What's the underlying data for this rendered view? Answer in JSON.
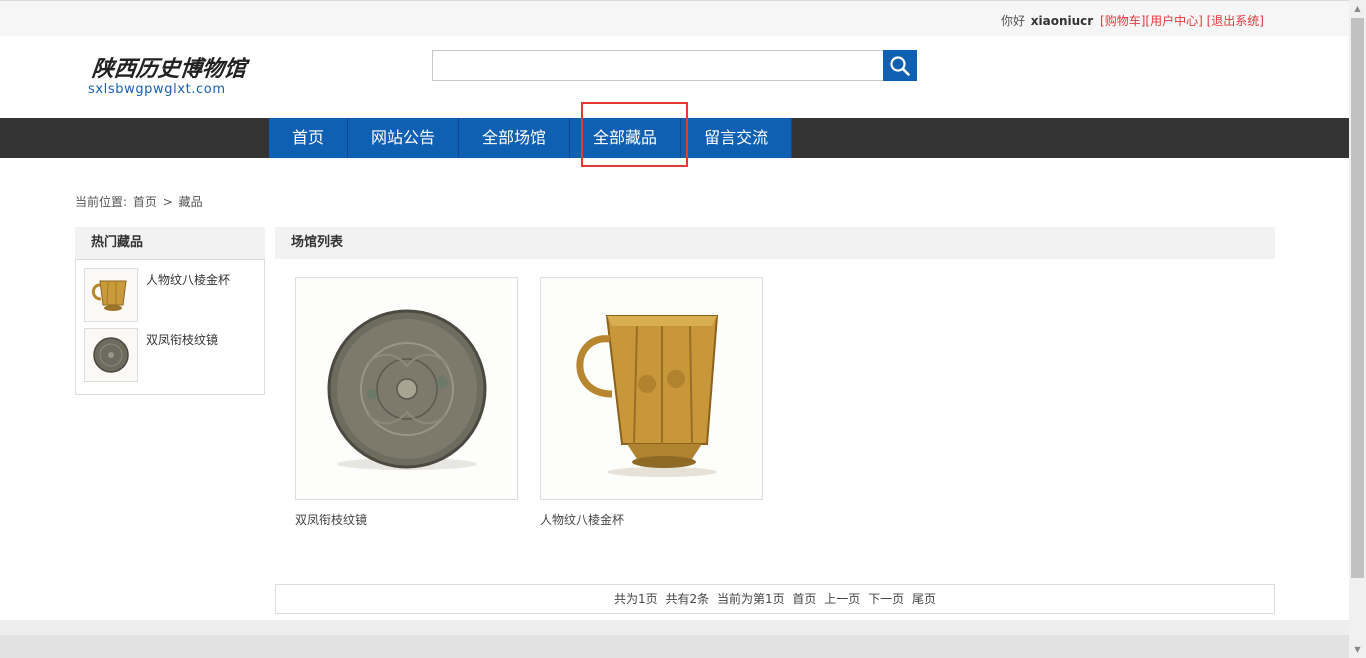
{
  "topbar": {
    "greeting": "你好",
    "username": "xiaoniucr",
    "links": [
      "[购物车]",
      "[用户中心]",
      "[退出系统]"
    ]
  },
  "header": {
    "logo_title": "陕西历史博物馆",
    "logo_sub": "sxlsbwgpwglxt.com",
    "search": {
      "value": "",
      "placeholder": ""
    }
  },
  "nav": {
    "items": [
      "首页",
      "网站公告",
      "全部场馆",
      "全部藏品",
      "留言交流"
    ],
    "highlighted": "全部藏品"
  },
  "breadcrumb": {
    "prefix": "当前位置:",
    "home": "首页",
    "sep": ">",
    "current": "藏品"
  },
  "sidebar": {
    "title": "热门藏品",
    "items": [
      {
        "label": "人物纹八棱金杯",
        "icon": "gold-cup-icon"
      },
      {
        "label": "双凤衔枝纹镜",
        "icon": "bronze-mirror-icon"
      }
    ]
  },
  "main": {
    "title": "场馆列表",
    "cards": [
      {
        "label": "双凤衔枝纹镜",
        "icon": "bronze-mirror-image"
      },
      {
        "label": "人物纹八棱金杯",
        "icon": "gold-cup-image"
      }
    ]
  },
  "pager": {
    "total_pages": "共为1页",
    "total_items": "共有2条",
    "current": "当前为第1页",
    "first": "首页",
    "prev": "上一页",
    "next": "下一页",
    "last": "尾页"
  },
  "colors": {
    "nav_blue": "#0f5fb3",
    "nav_bar": "#333333",
    "link_red": "#e4393c",
    "highlight": "#e53935"
  }
}
